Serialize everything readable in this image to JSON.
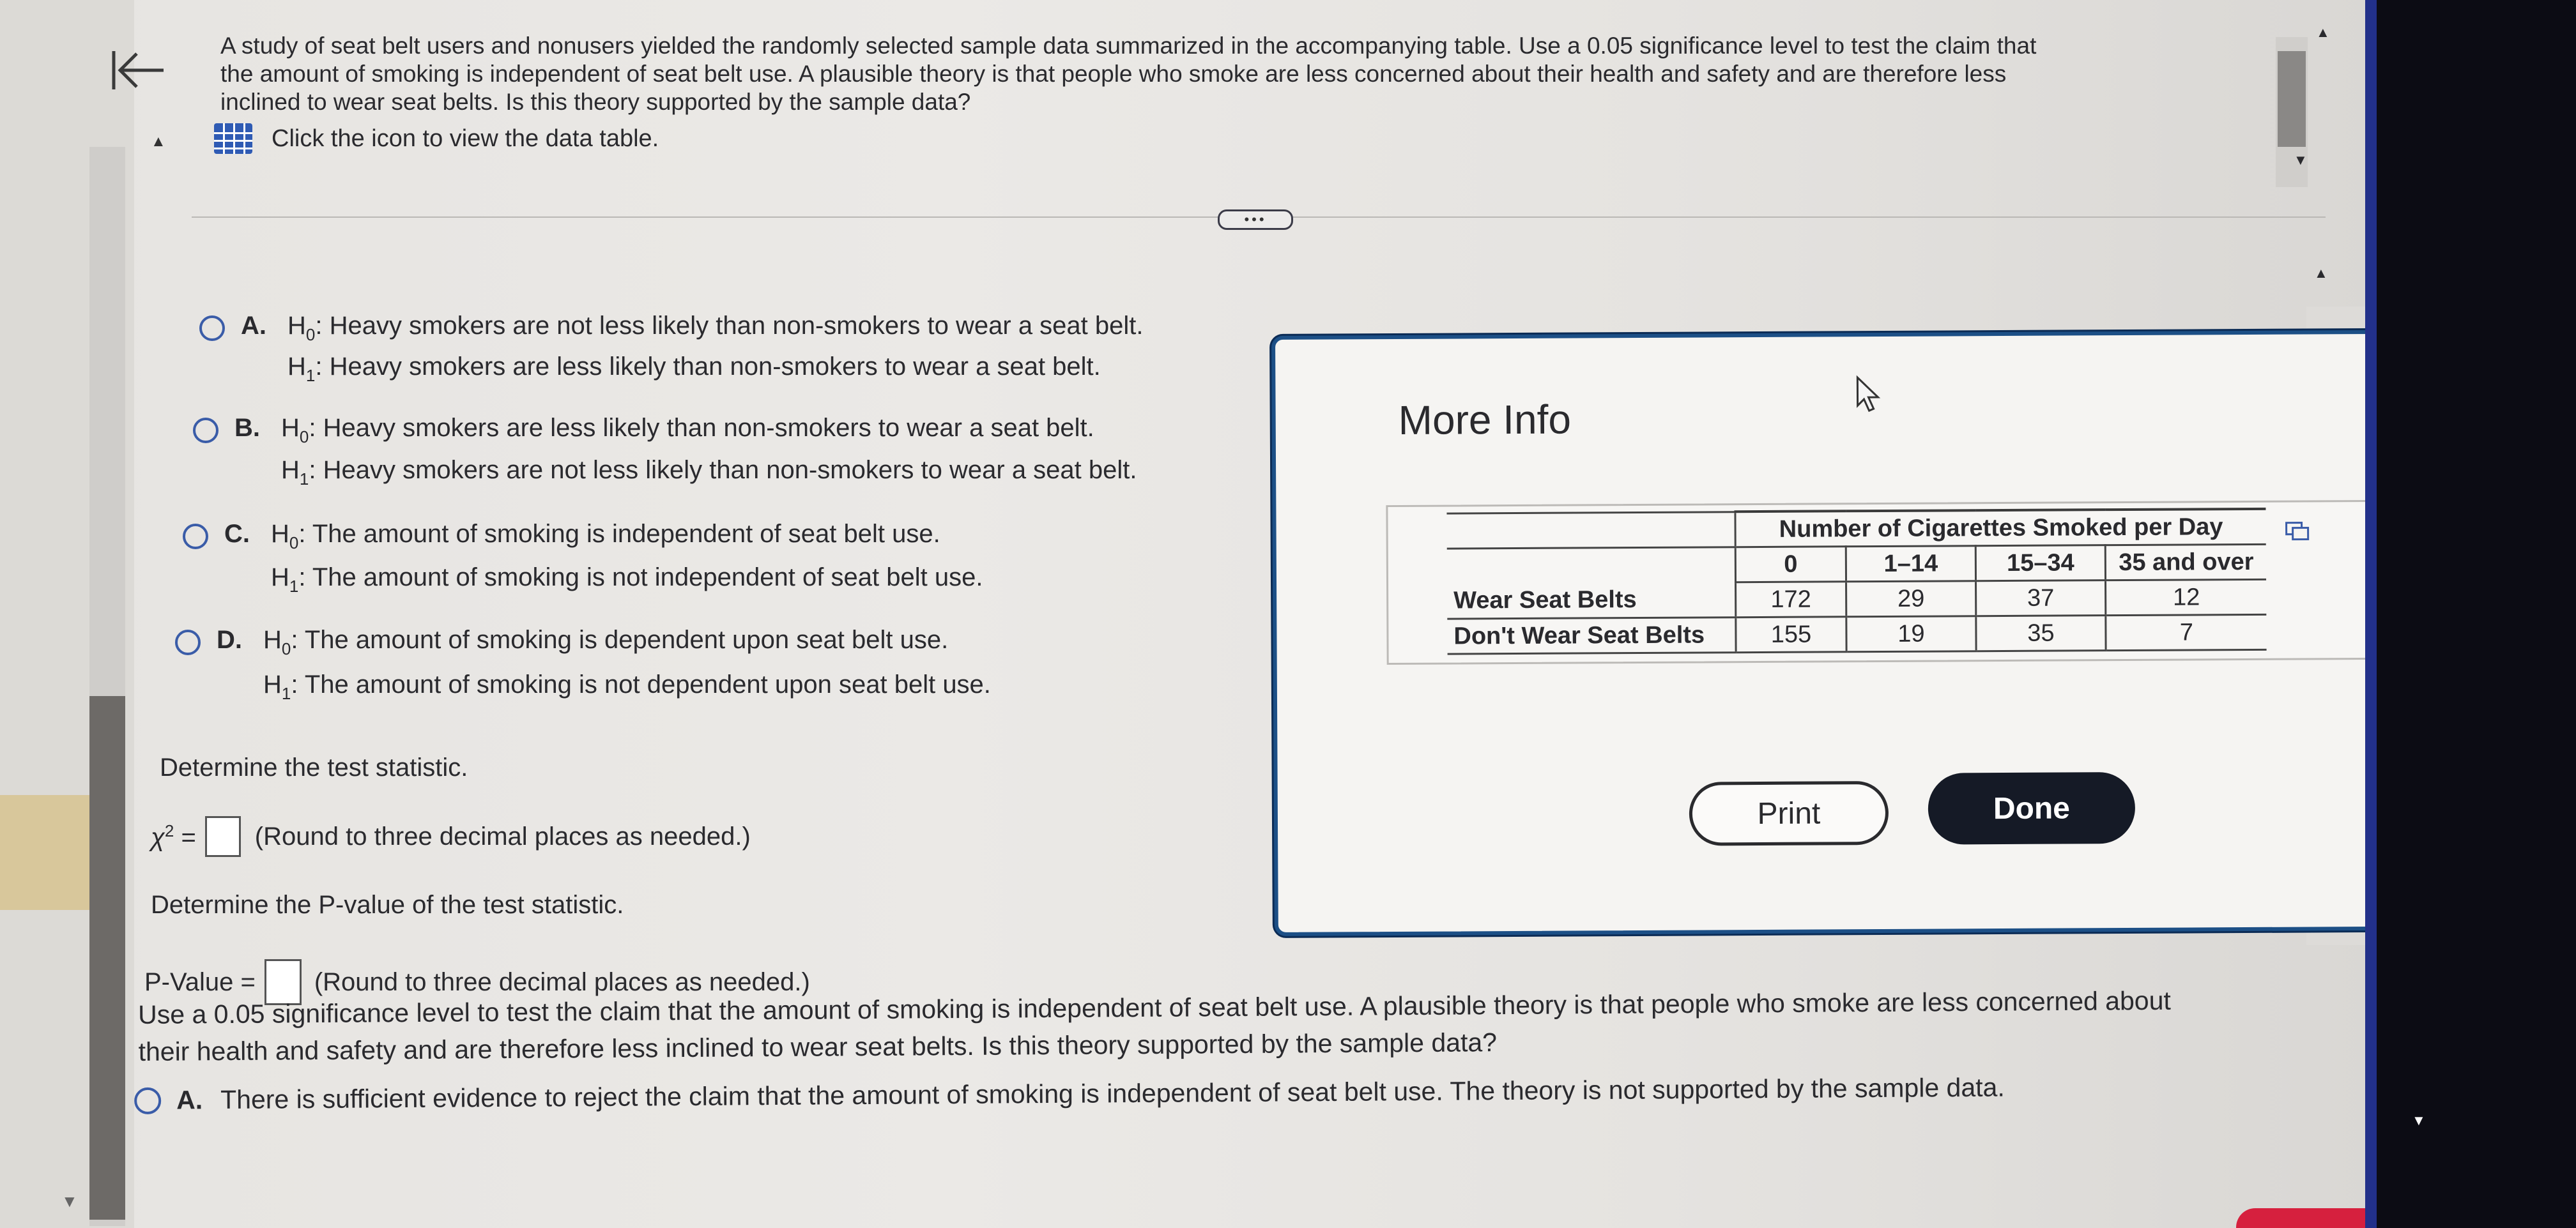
{
  "question": {
    "lines": [
      "A study of seat belt users and nonusers yielded the randomly selected sample data summarized in the accompanying table. Use a 0.05 significance level to test the claim that",
      "the amount of smoking is independent of seat belt use. A plausible theory is that people who smoke are less concerned about their health and safety and are therefore less",
      "inclined to wear seat belts. Is this theory supported by the sample data?"
    ],
    "data_table_link": "Click the icon to view the data table."
  },
  "options": [
    {
      "letter": "A.",
      "h0": "Heavy smokers are not less likely than non-smokers to wear a seat belt.",
      "h1": "Heavy smokers are less likely than non-smokers to wear a seat belt."
    },
    {
      "letter": "B.",
      "h0": "Heavy smokers are less likely than non-smokers to wear a seat belt.",
      "h1": "Heavy smokers are not less likely than non-smokers to wear a seat belt."
    },
    {
      "letter": "C.",
      "h0": "The amount of smoking is independent of seat belt use.",
      "h1": "The amount of smoking is not independent of seat belt use."
    },
    {
      "letter": "D.",
      "h0": "The amount of smoking is dependent upon seat belt use.",
      "h1": "The amount of smoking is not dependent upon seat belt use."
    }
  ],
  "hypothesis": {
    "h": "H",
    "null_sub": "0",
    "alt_sub": "1",
    "colon": ":"
  },
  "test_statistic": {
    "heading": "Determine the test statistic.",
    "symbol": "χ",
    "power": "2",
    "equals": "=",
    "hint": "(Round to three decimal places as needed.)"
  },
  "p_value": {
    "heading": "Determine the P-value of the test statistic.",
    "label": "P-Value =",
    "hint": "(Round to three decimal places as needed.)"
  },
  "conclusion": {
    "lines": [
      "Use a 0.05 significance level to test the claim that the amount of smoking is independent of seat belt use. A plausible theory is that people who smoke are less concerned about",
      "their health and safety and are therefore less inclined to wear seat belts. Is this theory supported by the sample data?"
    ],
    "option_a": {
      "letter": "A.",
      "text": "There is sufficient evidence to reject the claim that the amount of smoking is independent of seat belt use. The theory is not supported by the sample data."
    }
  },
  "dialog": {
    "title": "More Info",
    "table": {
      "group_header": "Number of Cigarettes Smoked per Day",
      "columns": [
        "0",
        "1–14",
        "15–34",
        "35 and over"
      ],
      "rows": [
        {
          "label": "Wear Seat Belts",
          "values": [
            "172",
            "29",
            "37",
            "12"
          ]
        },
        {
          "label": "Don't Wear Seat Belts",
          "values": [
            "155",
            "19",
            "35",
            "7"
          ]
        }
      ]
    },
    "print_label": "Print",
    "done_label": "Done"
  },
  "ui": {
    "expand_dots": "•••",
    "accent_color": "#3a5ca8",
    "dialog_border_color": "#1c4f86",
    "done_button_color": "#151a26"
  }
}
